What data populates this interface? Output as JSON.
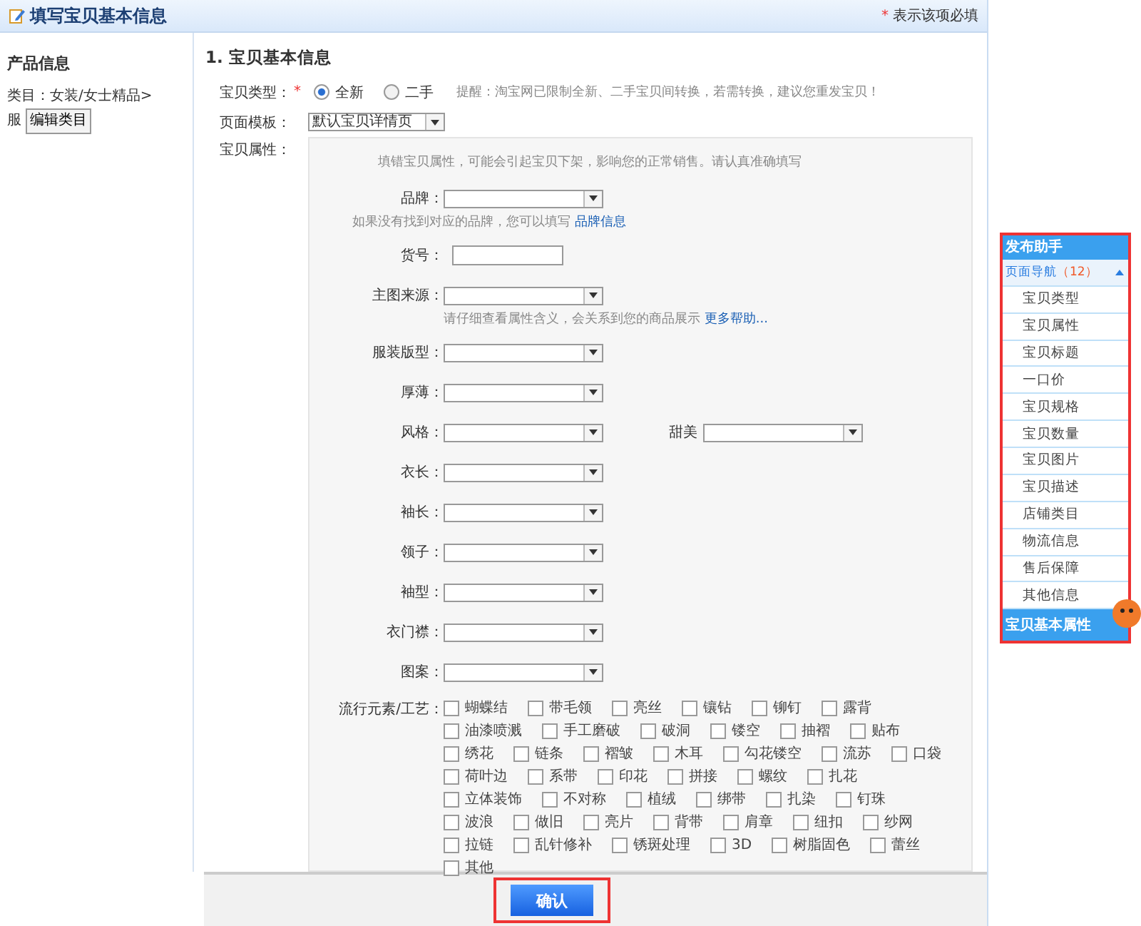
{
  "header": {
    "title": "填写宝贝基本信息",
    "required_note": "表示该项必填",
    "required_mark": "*"
  },
  "product_info": {
    "title": "产品信息",
    "category_label": "类目：女装/女士精品>",
    "category_tail": "服",
    "edit_button": "编辑类目"
  },
  "section_title": "1. 宝贝基本信息",
  "item_type": {
    "label": "宝贝类型：",
    "required_mark": "*",
    "options": [
      {
        "label": "全新",
        "selected": true
      },
      {
        "label": "二手",
        "selected": false
      }
    ],
    "reminder": "提醒：淘宝网已限制全新、二手宝贝间转换，若需转换，建议您重发宝贝！"
  },
  "page_template": {
    "label": "页面模板：",
    "value": "默认宝贝详情页"
  },
  "attributes": {
    "label": "宝贝属性：",
    "notice": "填错宝贝属性，可能会引起宝贝下架，影响您的正常销售。请认真准确填写",
    "fields": [
      {
        "kind": "select",
        "label": "品牌：",
        "hint": "如果没有找到对应的品牌，您可以填写",
        "hint_link": "品牌信息"
      },
      {
        "kind": "input",
        "label": "货号："
      },
      {
        "kind": "select",
        "label": "主图来源：",
        "hint": "请仔细查看属性含义，会关系到您的商品展示",
        "hint_link": "更多帮助..."
      },
      {
        "kind": "select",
        "label": "服装版型："
      },
      {
        "kind": "select",
        "label": "厚薄："
      },
      {
        "kind": "select",
        "label": "风格：",
        "extra_label": "甜美"
      },
      {
        "kind": "select",
        "label": "衣长："
      },
      {
        "kind": "select",
        "label": "袖长："
      },
      {
        "kind": "select",
        "label": "领子："
      },
      {
        "kind": "select",
        "label": "袖型："
      },
      {
        "kind": "select",
        "label": "衣门襟："
      },
      {
        "kind": "select",
        "label": "图案："
      }
    ],
    "elements_label": "流行元素/工艺：",
    "elements": [
      {
        "label": "蝴蝶结",
        "checked": false
      },
      {
        "label": "带毛领",
        "checked": false
      },
      {
        "label": "亮丝",
        "checked": false
      },
      {
        "label": "镶钻",
        "checked": false
      },
      {
        "label": "铆钉",
        "checked": false
      },
      {
        "label": "露背",
        "checked": false
      },
      {
        "label": "油漆喷溅",
        "checked": false
      },
      {
        "label": "手工磨破",
        "checked": false
      },
      {
        "label": "破洞",
        "checked": false
      },
      {
        "label": "镂空",
        "checked": false
      },
      {
        "label": "抽褶",
        "checked": false
      },
      {
        "label": "贴布",
        "checked": false
      },
      {
        "label": "绣花",
        "checked": false
      },
      {
        "label": "链条",
        "checked": false
      },
      {
        "label": "褶皱",
        "checked": false
      },
      {
        "label": "木耳",
        "checked": false
      },
      {
        "label": "勾花镂空",
        "checked": false
      },
      {
        "label": "流苏",
        "checked": false
      },
      {
        "label": "口袋",
        "checked": false
      },
      {
        "label": "荷叶边",
        "checked": false
      },
      {
        "label": "系带",
        "checked": false
      },
      {
        "label": "印花",
        "checked": false
      },
      {
        "label": "拼接",
        "checked": false
      },
      {
        "label": "螺纹",
        "checked": false
      },
      {
        "label": "扎花",
        "checked": false
      },
      {
        "label": "立体装饰",
        "checked": false
      },
      {
        "label": "不对称",
        "checked": false
      },
      {
        "label": "植绒",
        "checked": false
      },
      {
        "label": "绑带",
        "checked": false
      },
      {
        "label": "扎染",
        "checked": false
      },
      {
        "label": "钉珠",
        "checked": false
      },
      {
        "label": "波浪",
        "checked": false
      },
      {
        "label": "做旧",
        "checked": false
      },
      {
        "label": "亮片",
        "checked": false
      },
      {
        "label": "背带",
        "checked": false
      },
      {
        "label": "肩章",
        "checked": false
      },
      {
        "label": "纽扣",
        "checked": false
      },
      {
        "label": "纱网",
        "checked": false
      },
      {
        "label": "拉链",
        "checked": false
      },
      {
        "label": "乱针修补",
        "checked": false
      },
      {
        "label": "锈斑处理",
        "checked": false
      },
      {
        "label": "3D",
        "checked": false
      },
      {
        "label": "树脂固色",
        "checked": false
      },
      {
        "label": "蕾丝",
        "checked": false
      },
      {
        "label": "其他",
        "checked": false
      }
    ]
  },
  "confirm_button": "确认",
  "assistant": {
    "title": "发布助手",
    "nav_label": "页面导航",
    "nav_count": "（12）",
    "expanded": true,
    "items": [
      "宝贝类型",
      "宝贝属性",
      "宝贝标题",
      "一口价",
      "宝贝规格",
      "宝贝数量",
      "宝贝图片",
      "宝贝描述",
      "店铺类目",
      "物流信息",
      "售后保障",
      "其他信息"
    ],
    "footer": "宝贝基本属性"
  }
}
